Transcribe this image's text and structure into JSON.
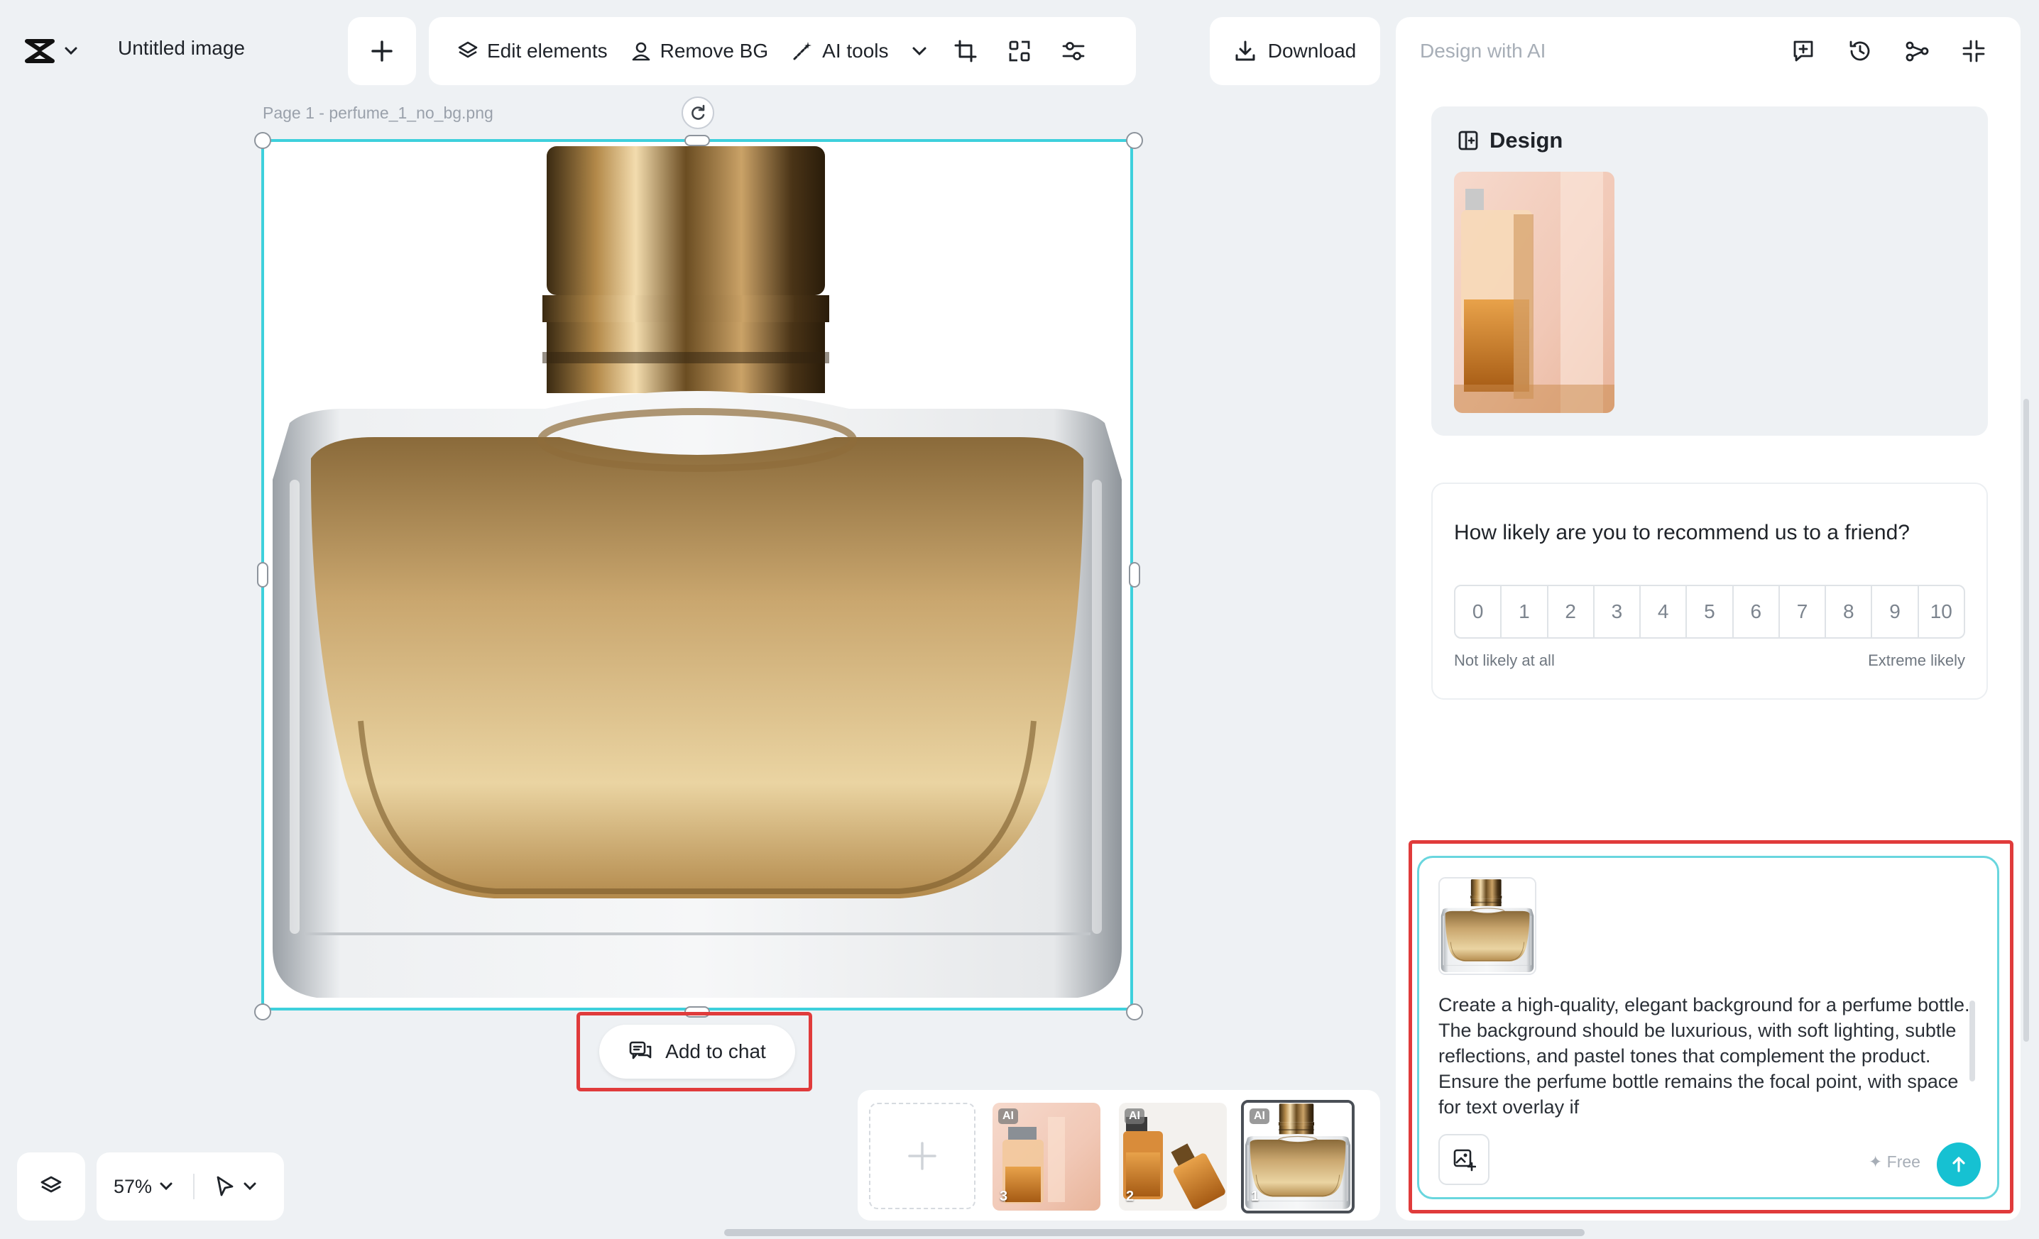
{
  "header": {
    "doc_title": "Untitled image",
    "toolbar": {
      "edit_elements": "Edit elements",
      "remove_bg": "Remove BG",
      "ai_tools": "AI tools"
    },
    "download_label": "Download"
  },
  "canvas": {
    "page_label": "Page 1 -   perfume_1_no_bg.png",
    "add_to_chat_label": "Add to chat"
  },
  "bottom_controls": {
    "zoom": "57%"
  },
  "thumbnails": [
    {
      "number": "3",
      "badge": "AI"
    },
    {
      "number": "2",
      "badge": "AI"
    },
    {
      "number": "1",
      "badge": "AI"
    }
  ],
  "panel": {
    "title": "Design with AI",
    "design_card_title": "Design",
    "survey": {
      "question": "How likely are you to recommend us to a friend?",
      "scale": [
        "0",
        "1",
        "2",
        "3",
        "4",
        "5",
        "6",
        "7",
        "8",
        "9",
        "10"
      ],
      "low_label": "Not likely at all",
      "high_label": "Extreme likely"
    },
    "chat": {
      "prompt_text": "Create a high-quality, elegant background for a perfume bottle. The background should be luxurious, with soft lighting, subtle reflections, and pastel tones that complement the product. Ensure the perfume bottle remains the focal point, with space for text overlay if",
      "free_label": "✦ Free"
    }
  },
  "colors": {
    "accent": "#16c1d2",
    "selection": "#3ed0dc",
    "highlight": "#e03b3b"
  }
}
